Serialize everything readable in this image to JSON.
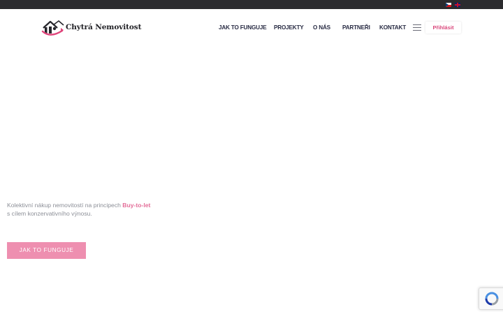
{
  "topbar": {
    "languages": [
      {
        "code": "cs",
        "icon": "flag-cz-icon"
      },
      {
        "code": "en",
        "icon": "flag-gb-icon"
      }
    ]
  },
  "header": {
    "logo_text": "Chytrá Nemovitost",
    "nav": [
      {
        "label": "JAK TO FUNGUJE"
      },
      {
        "label": "PROJEKTY"
      },
      {
        "label": "O NÁS"
      },
      {
        "label": "PARTNEŘI"
      },
      {
        "label": "KONTAKT"
      }
    ],
    "menu_icon": "hamburger-icon",
    "login_label": "Přihlásit"
  },
  "hero": {
    "line1_prefix": "Kolektivní nákup nemovitostí na principech ",
    "line1_accent": "Buy-to-let",
    "line2": "s cílem konzervativního výnosu.",
    "cta_label": "JAK TO FUNGUJE"
  },
  "colors": {
    "accent": "#e36d98",
    "button": "#ee8fb0",
    "topbar": "#2b2b2e",
    "nav_text": "#2a2d45"
  },
  "recaptcha": {
    "icon": "recaptcha-icon"
  }
}
